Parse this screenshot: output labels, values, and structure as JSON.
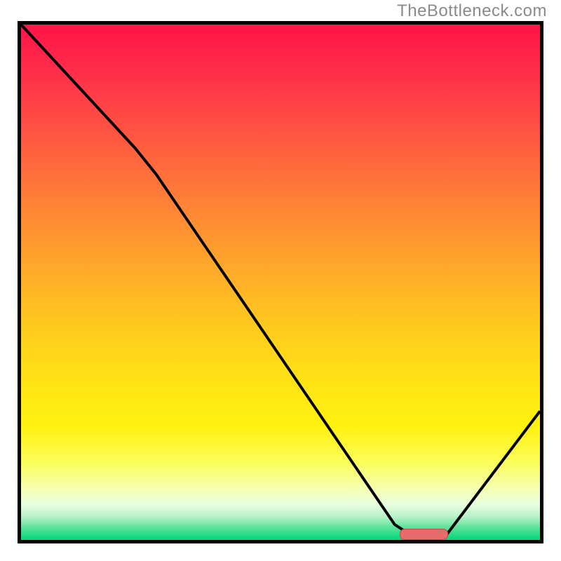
{
  "watermark": "TheBottleneck.com",
  "chart_data": {
    "type": "line",
    "title": "",
    "xlabel": "",
    "ylabel": "",
    "x_range": [
      0,
      100
    ],
    "y_range": [
      0,
      100
    ],
    "curve": [
      {
        "x": 0,
        "y": 100
      },
      {
        "x": 22,
        "y": 76
      },
      {
        "x": 26,
        "y": 71
      },
      {
        "x": 72,
        "y": 3
      },
      {
        "x": 75,
        "y": 1
      },
      {
        "x": 82,
        "y": 1
      },
      {
        "x": 100,
        "y": 25
      }
    ],
    "marker": {
      "x_start": 73,
      "x_end": 82,
      "color": "#e76b6b"
    },
    "gradient_top_color": "#ff1548",
    "gradient_bottom_color": "#00d67a"
  }
}
